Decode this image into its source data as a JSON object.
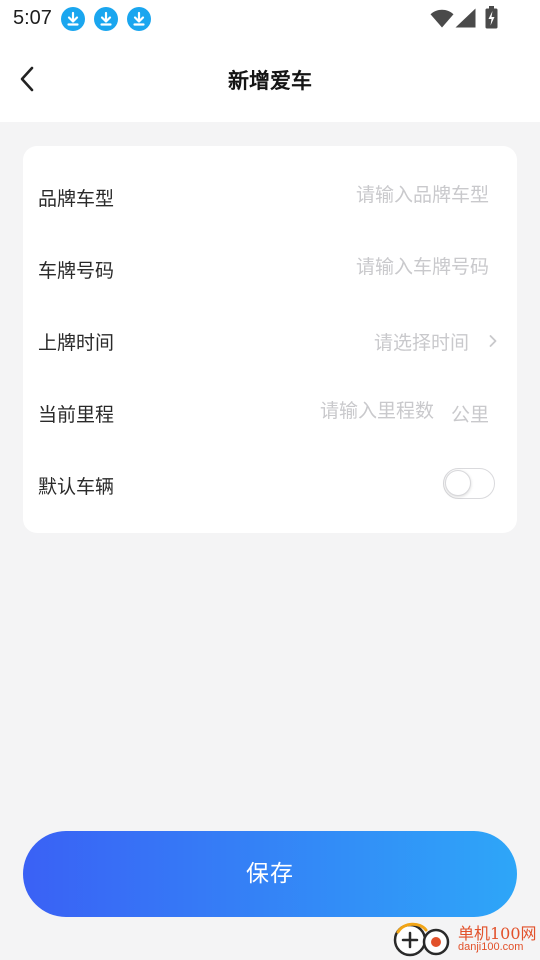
{
  "status_bar": {
    "time": "5:07",
    "notification_icons": [
      "download-icon",
      "download-icon",
      "download-icon"
    ],
    "system_icons": [
      "wifi-icon",
      "signal-icon",
      "battery-charging-icon"
    ]
  },
  "header": {
    "back_icon": "chevron-left-icon",
    "title": "新增爱车"
  },
  "form": {
    "rows": [
      {
        "label": "品牌车型",
        "placeholder": "请输入品牌车型",
        "value": ""
      },
      {
        "label": "车牌号码",
        "placeholder": "请输入车牌号码",
        "value": ""
      },
      {
        "label": "上牌时间",
        "placeholder": "请选择时间",
        "value": ""
      },
      {
        "label": "当前里程",
        "placeholder": "请输入里程数",
        "value": "",
        "unit": "公里"
      },
      {
        "label": "默认车辆",
        "toggle_on": false
      }
    ]
  },
  "save_button": {
    "label": "保存"
  },
  "watermark": {
    "name": "单机100网",
    "url": "danji100.com"
  },
  "colors": {
    "background": "#f4f4f5",
    "card": "#ffffff",
    "placeholder": "#c9c9cc",
    "button_gradient_start": "#3a61f5",
    "button_gradient_end": "#2ea6f8",
    "status_download": "#1aa6ef"
  }
}
